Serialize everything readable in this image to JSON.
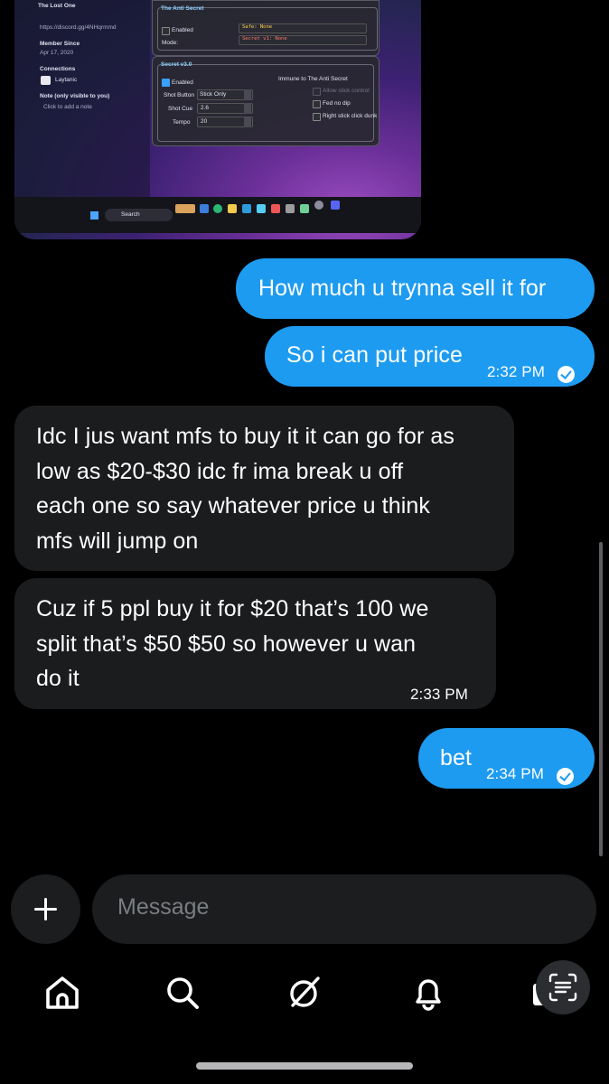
{
  "attachment": {
    "profile_name": "The Lost One",
    "profile_link": "https://discord.gg/4NHqrmmd",
    "member_since_label": "Member Since",
    "member_since_value": "Apr 17, 2020",
    "connections_label": "Connections",
    "connection_name": "Laytanic",
    "note_label": "Note (only visible to you)",
    "note_placeholder": "Click to add a note",
    "panel1_title": "The Anti Secret",
    "panel1_enabled": "Enabled",
    "panel1_mode": "Mode:",
    "panel1_value1": "Safe: None",
    "panel1_value2": "Secret v1: None",
    "panel2_title": "Secret v3.0",
    "panel2_enabled": "Enabled",
    "panel2_immune": "Immune to The Anti Secret",
    "shot_button_label": "Shot Button",
    "shot_button_value": "Stick Only",
    "shot_cue_label": "Shot Cue",
    "shot_cue_value": "2.6",
    "tempo_label": "Tempo",
    "tempo_value": "20",
    "opt1": "Allow stick control",
    "opt2": "Fed no dip",
    "opt3": "Right stick click dunk",
    "search_label": "Search"
  },
  "messages": {
    "m1_text": "How much u trynna sell it for",
    "m2_text": "So i can put price",
    "m2_time": "2:32 PM",
    "m3_lines": [
      "Idc I jus want mfs to buy it it can go for as",
      "low as $20-$30 idc fr ima break u off",
      "each one so say whatever price u think",
      "mfs will jump on"
    ],
    "m4_lines": [
      "Cuz if 5 ppl buy it for $20 that’s 100 we",
      "split that’s $50 $50 so however u wan",
      "do it"
    ],
    "m4_time": "2:33 PM",
    "m5_text": "bet",
    "m5_time": "2:34 PM"
  },
  "composer": {
    "placeholder": "Message"
  },
  "nav": [
    "home-icon",
    "search-icon",
    "grok-icon",
    "bell-icon",
    "mail-icon"
  ],
  "colors": {
    "outgoing_bubble": "#1d9bf0",
    "incoming_bubble": "#1b1c1e",
    "background": "#000000"
  }
}
